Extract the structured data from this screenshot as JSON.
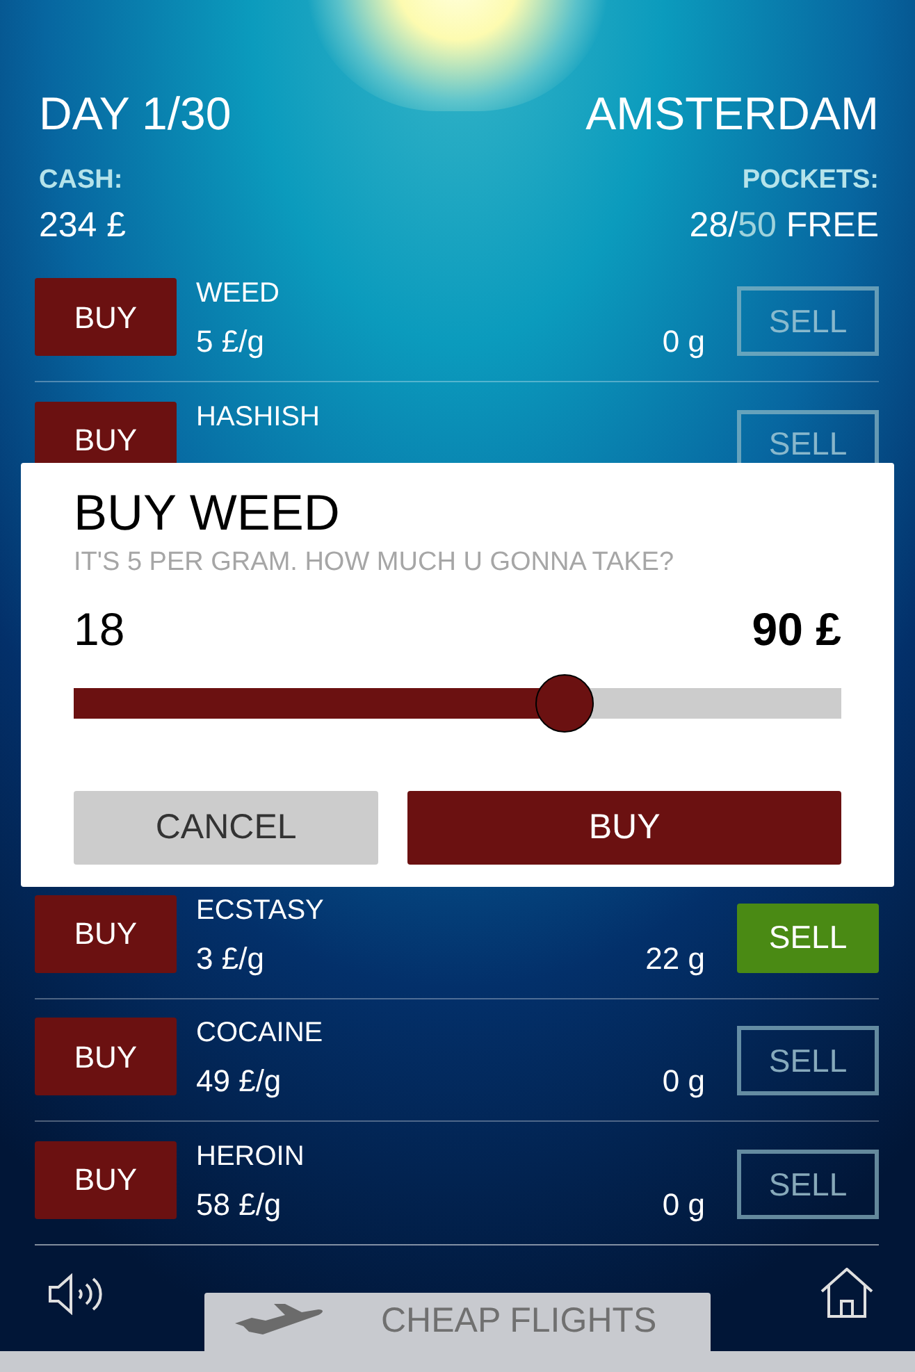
{
  "header": {
    "day": "DAY 1/30",
    "city": "AMSTERDAM",
    "cash_label": "CASH:",
    "cash": "234 £",
    "pockets_label": "POCKETS:",
    "pockets": {
      "used": "28/",
      "capacity": "50",
      "suffix": "FREE"
    }
  },
  "drugs": [
    {
      "name": "WEED",
      "price": "5 £/g",
      "owned": "0 g",
      "buy": "BUY",
      "sell": "SELL",
      "sell_disabled": true
    },
    {
      "name": "HASHISH",
      "buy": "BUY",
      "sell": "SELL",
      "sell_disabled": true
    },
    {
      "name": "ECSTASY",
      "price": "3 £/g",
      "owned": "22 g",
      "buy": "BUY",
      "sell": "SELL",
      "sell_disabled": false
    },
    {
      "name": "COCAINE",
      "price": "49 £/g",
      "owned": "0 g",
      "buy": "BUY",
      "sell": "SELL",
      "sell_disabled": true
    },
    {
      "name": "HEROIN",
      "price": "58 £/g",
      "owned": "0 g",
      "buy": "BUY",
      "sell": "SELL",
      "sell_disabled": true
    }
  ],
  "dialog": {
    "title": "BUY WEED",
    "message": "IT'S 5 PER GRAM. HOW MUCH U GONNA TAKE?",
    "amount": "18",
    "total": "90 £",
    "slider": {
      "level": 0.64
    },
    "buttons": [
      {
        "label": "CANCEL",
        "kind": "secondary"
      },
      {
        "label": "BUY",
        "kind": "primary"
      }
    ]
  },
  "footer": {
    "flights_button": "CHEAP FLIGHTS"
  }
}
